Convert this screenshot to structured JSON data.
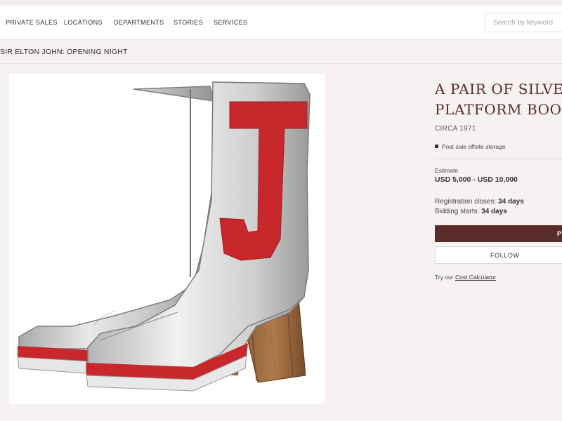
{
  "nav": {
    "items": [
      "PRIVATE SALES",
      "LOCATIONS",
      "DEPARTMENTS",
      "STORIES",
      "SERVICES"
    ],
    "search_placeholder": "Search by keyword"
  },
  "breadcrumb": "SIR ELTON JOHN: OPENING NIGHT",
  "lot": {
    "title_line1": "A PAIR OF SILVE",
    "title_line2": "PLATFORM BOO",
    "circa": "CIRCA 1971",
    "storage_note": "Post sale offsite storage",
    "estimate_label": "Estimate",
    "estimate_value": "USD 5,000 - USD 10,000",
    "registration_label": "Registration closes: ",
    "registration_value": "34 days",
    "bidding_label": "Bidding starts: ",
    "bidding_value": "34 days",
    "primary_button_label": "P",
    "follow_label": "FOLLOW",
    "calc_prefix": "Try our ",
    "calc_link": "Cost Calculator"
  },
  "colors": {
    "accent": "#5b2c2c",
    "page_bg": "#f7f2f2",
    "title": "#5a2a2a"
  },
  "image": {
    "subject": "silver platform boots with red J"
  }
}
